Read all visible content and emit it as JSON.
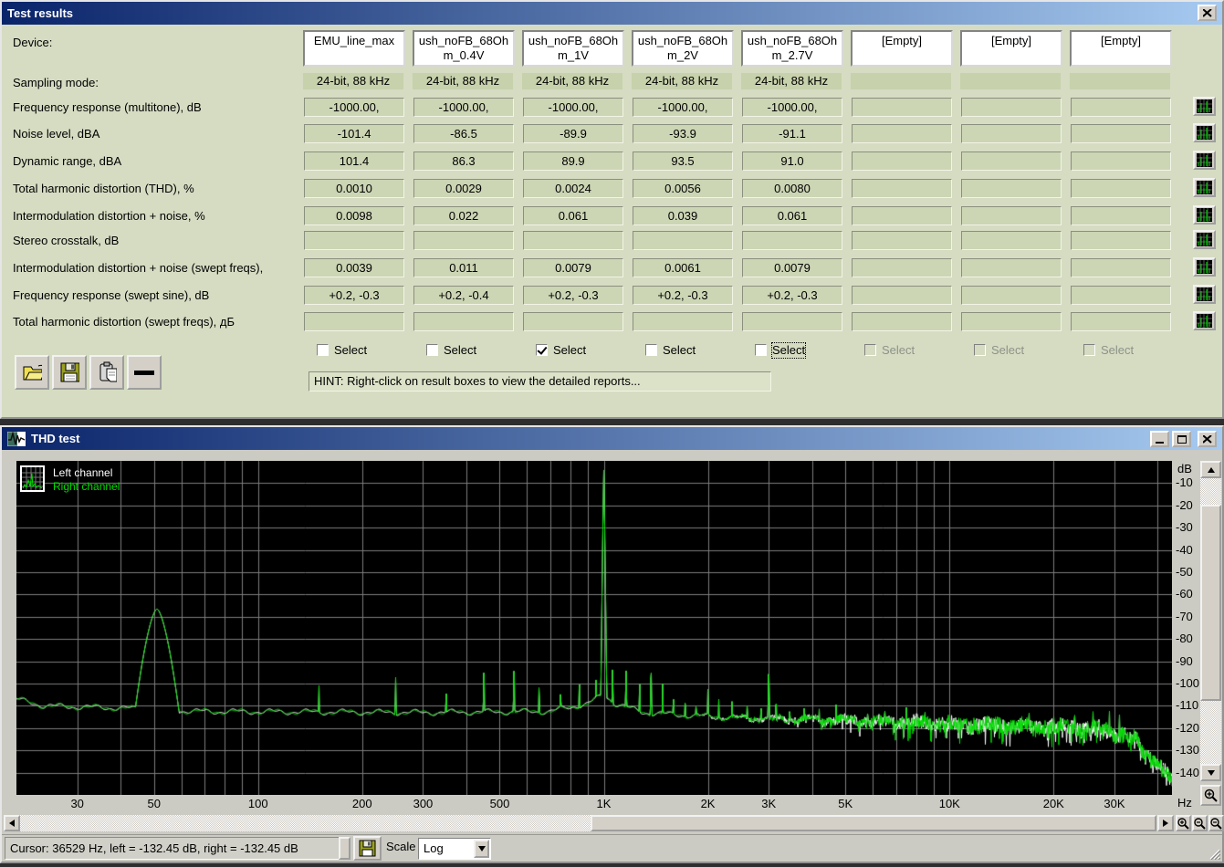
{
  "colors": {
    "titlebar_start": "#0a246a",
    "titlebar_end": "#a6caf0",
    "results_window_bg": "#d5dcc2",
    "plot_bg": "#000000",
    "grid_color": "#7d7d7d",
    "left_channel_color": "#ffffff",
    "right_channel_color": "#00dc00"
  },
  "window_results": {
    "title": "Test results",
    "device_label": "Device:",
    "sampling_label": "Sampling mode:",
    "devices": [
      "EMU_line_max",
      "ush_noFB_68Ohm_0.4V",
      "ush_noFB_68Ohm_1V",
      "ush_noFB_68Ohm_2V",
      "ush_noFB_68Ohm_2.7V",
      "[Empty]",
      "[Empty]",
      "[Empty]"
    ],
    "sampling_modes": [
      "24-bit, 88 kHz",
      "24-bit, 88 kHz",
      "24-bit, 88 kHz",
      "24-bit, 88 kHz",
      "24-bit, 88 kHz",
      "",
      "",
      ""
    ],
    "measurements": [
      {
        "label": "Frequency response (multitone), dB",
        "values": [
          "-1000.00,",
          "-1000.00,",
          "-1000.00,",
          "-1000.00,",
          "-1000.00,",
          "",
          "",
          ""
        ]
      },
      {
        "label": "Noise level, dBA",
        "values": [
          "-101.4",
          "-86.5",
          "-89.9",
          "-93.9",
          "-91.1",
          "",
          "",
          ""
        ]
      },
      {
        "label": "Dynamic range, dBA",
        "values": [
          "101.4",
          "86.3",
          "89.9",
          "93.5",
          "91.0",
          "",
          "",
          ""
        ]
      },
      {
        "label": "Total harmonic distortion (THD), %",
        "values": [
          "0.0010",
          "0.0029",
          "0.0024",
          "0.0056",
          "0.0080",
          "",
          "",
          ""
        ]
      },
      {
        "label": "Intermodulation distortion + noise, %",
        "values": [
          "0.0098",
          "0.022",
          "0.061",
          "0.039",
          "0.061",
          "",
          "",
          ""
        ]
      },
      {
        "label": "Stereo crosstalk, dB",
        "values": [
          "",
          "",
          "",
          "",
          "",
          "",
          "",
          ""
        ]
      },
      {
        "label": "Intermodulation distortion + noise (swept freqs),",
        "values": [
          "0.0039",
          "0.011",
          "0.0079",
          "0.0061",
          "0.0079",
          "",
          "",
          ""
        ]
      },
      {
        "label": "Frequency response (swept sine), dB",
        "values": [
          "+0.2, -0.3",
          "+0.2, -0.4",
          "+0.2, -0.3",
          "+0.2, -0.3",
          "+0.2, -0.3",
          "",
          "",
          ""
        ]
      },
      {
        "label": "Total harmonic distortion (swept freqs), дБ",
        "values": [
          "",
          "",
          "",
          "",
          "",
          "",
          "",
          ""
        ]
      }
    ],
    "select_label": "Select",
    "selects": [
      {
        "checked": false,
        "enabled": true,
        "focused": false
      },
      {
        "checked": false,
        "enabled": true,
        "focused": false
      },
      {
        "checked": true,
        "enabled": true,
        "focused": false
      },
      {
        "checked": false,
        "enabled": true,
        "focused": false
      },
      {
        "checked": false,
        "enabled": true,
        "focused": true
      },
      {
        "checked": false,
        "enabled": false,
        "focused": false
      },
      {
        "checked": false,
        "enabled": false,
        "focused": false
      },
      {
        "checked": false,
        "enabled": false,
        "focused": false
      }
    ],
    "hint": "HINT: Right-click on result boxes to view the detailed reports...",
    "toolbar": [
      {
        "name": "open-report-button",
        "icon": "folder-open-icon"
      },
      {
        "name": "save-report-button",
        "icon": "save-icon"
      },
      {
        "name": "copy-report-button",
        "icon": "copy-icon"
      },
      {
        "name": "remove-device-button",
        "icon": "minus-icon"
      }
    ]
  },
  "window_thd": {
    "title": "THD test",
    "status": {
      "cursor_text": "Cursor:  36529 Hz,  left = -132.45 dB,  right = -132.45 dB",
      "scale_label": "Scale",
      "scale_value": "Log"
    }
  },
  "chart_data": {
    "type": "line",
    "title": "THD test spectrum",
    "xlabel": "Hz",
    "ylabel": "dB",
    "xscale": "log",
    "xrange": [
      20,
      44000
    ],
    "yrange": [
      -150,
      0
    ],
    "grid": true,
    "legend_position": "top-left",
    "x_ticks": [
      {
        "value": 30,
        "label": "30"
      },
      {
        "value": 50,
        "label": "50"
      },
      {
        "value": 100,
        "label": "100"
      },
      {
        "value": 200,
        "label": "200"
      },
      {
        "value": 300,
        "label": "300"
      },
      {
        "value": 500,
        "label": "500"
      },
      {
        "value": 1000,
        "label": "1K"
      },
      {
        "value": 2000,
        "label": "2K"
      },
      {
        "value": 3000,
        "label": "3K"
      },
      {
        "value": 5000,
        "label": "5K"
      },
      {
        "value": 10000,
        "label": "10K"
      },
      {
        "value": 20000,
        "label": "20K"
      },
      {
        "value": 30000,
        "label": "30K"
      }
    ],
    "y_ticks": [
      "-10",
      "-20",
      "-30",
      "-40",
      "-50",
      "-60",
      "-70",
      "-80",
      "-90",
      "-100",
      "-110",
      "-120",
      "-130",
      "-140"
    ],
    "series": [
      {
        "name": "Left channel",
        "color": "#ffffff"
      },
      {
        "name": "Right channel",
        "color": "#00dc00"
      }
    ],
    "noise_floor": [
      [
        20,
        -107
      ],
      [
        24,
        -110
      ],
      [
        30,
        -110.5
      ],
      [
        40,
        -111
      ],
      [
        65,
        -112.5
      ],
      [
        300,
        -113
      ],
      [
        700,
        -112.5
      ],
      [
        900,
        -109
      ],
      [
        1000,
        -105
      ],
      [
        1080,
        -109
      ],
      [
        1300,
        -113
      ],
      [
        1600,
        -114
      ],
      [
        2500,
        -115.5
      ],
      [
        5000,
        -116.5
      ],
      [
        9000,
        -118
      ],
      [
        15000,
        -119
      ],
      [
        22000,
        -119.5
      ],
      [
        28000,
        -121
      ],
      [
        32000,
        -123
      ],
      [
        35000,
        -126
      ],
      [
        36500,
        -132.45
      ],
      [
        38000,
        -133
      ],
      [
        40000,
        -136
      ],
      [
        42000,
        -139
      ],
      [
        43500,
        -144
      ]
    ],
    "hump": {
      "center_hz": 51,
      "peak_db": -66.5,
      "width_decades": 0.062
    },
    "spikes": [
      [
        150,
        -100
      ],
      [
        250,
        -97
      ],
      [
        350,
        -101
      ],
      [
        450,
        -92
      ],
      [
        550,
        -91
      ],
      [
        650,
        -99
      ],
      [
        750,
        -101
      ],
      [
        850,
        -96
      ],
      [
        950,
        -97
      ],
      [
        988,
        -78
      ],
      [
        1000,
        -4
      ],
      [
        1060,
        -92
      ],
      [
        1160,
        -93
      ],
      [
        1270,
        -97
      ],
      [
        1370,
        -91
      ],
      [
        1480,
        -100
      ],
      [
        1590,
        -103
      ],
      [
        1720,
        -104
      ],
      [
        1850,
        -106
      ],
      [
        2000,
        -102
      ],
      [
        2150,
        -106
      ],
      [
        2350,
        -107
      ],
      [
        2600,
        -106
      ],
      [
        2850,
        -107
      ],
      [
        3000,
        -91
      ],
      [
        3150,
        -104
      ],
      [
        3450,
        -108
      ],
      [
        3800,
        -109
      ],
      [
        4200,
        -110
      ],
      [
        4700,
        -108
      ],
      [
        5200,
        -111
      ],
      [
        5800,
        -110
      ],
      [
        6500,
        -111
      ],
      [
        7500,
        -110
      ],
      [
        8500,
        -112
      ],
      [
        10000,
        -113
      ],
      [
        12000,
        -112
      ],
      [
        14000,
        -113
      ],
      [
        17000,
        -112
      ],
      [
        20000,
        -111
      ],
      [
        23000,
        -110
      ],
      [
        26000,
        -112
      ],
      [
        29000,
        -111
      ],
      [
        31000,
        -112
      ]
    ],
    "noise_fuzz": {
      "smooth_db": 1.0,
      "max_db": 7,
      "start_log10": 3.25,
      "full_log10": 4.0
    }
  }
}
